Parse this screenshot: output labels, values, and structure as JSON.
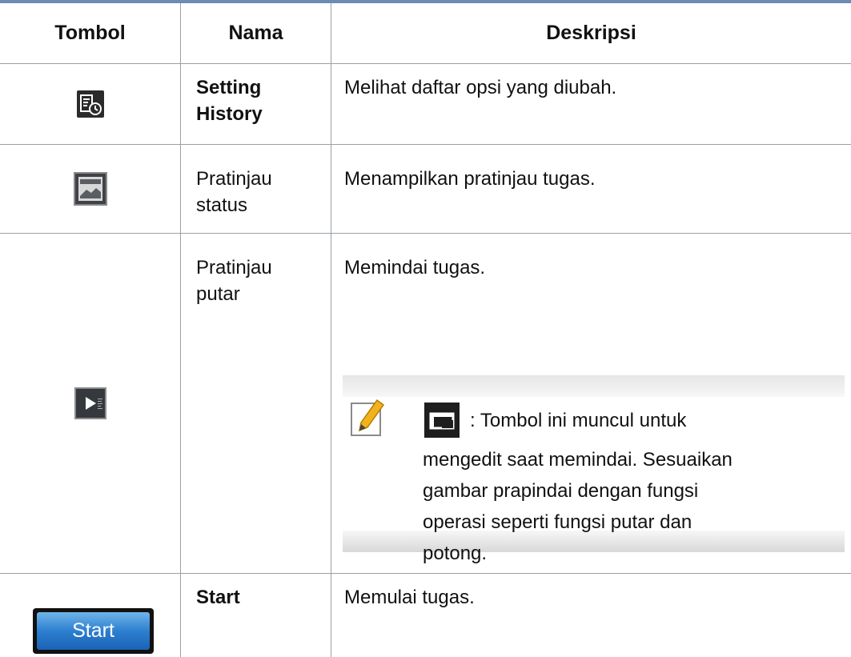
{
  "header": {
    "col_tombol": "Tombol",
    "col_nama": "Nama",
    "col_deskripsi": "Deskripsi"
  },
  "rows": [
    {
      "icon": "setting-history-icon",
      "name": "Setting History",
      "name_bold": true,
      "description": "Melihat daftar opsi yang diubah."
    },
    {
      "icon": "preview-status-icon",
      "name": "Pratinjau status",
      "name_bold": false,
      "description": "Menampilkan pratinjau tugas."
    },
    {
      "icon": "preview-play-icon",
      "name": "Pratinjau putar",
      "name_bold": false,
      "description": "Memindai tugas."
    },
    {
      "icon": "start-button",
      "name": "Start",
      "name_bold": true,
      "description": "Memulai tugas."
    }
  ],
  "name_lines": {
    "r0_l1": "Setting",
    "r0_l2": "History",
    "r1_l1": "Pratinjau",
    "r1_l2": "status",
    "r2_l1": "Pratinjau",
    "r2_l2": "putar"
  },
  "note": {
    "icon": "note-pencil-icon",
    "inline_icon": "crop-edit-icon",
    "line1": ": Tombol ini muncul untuk",
    "line2": "mengedit saat memindai. Sesuaikan",
    "line3": "gambar prapindai dengan fungsi",
    "line4": "operasi seperti fungsi putar dan",
    "line5": "potong."
  },
  "start_label": "Start",
  "colors": {
    "top_rule": "#6c8bb5",
    "start_blue": "#2d7fcf"
  }
}
